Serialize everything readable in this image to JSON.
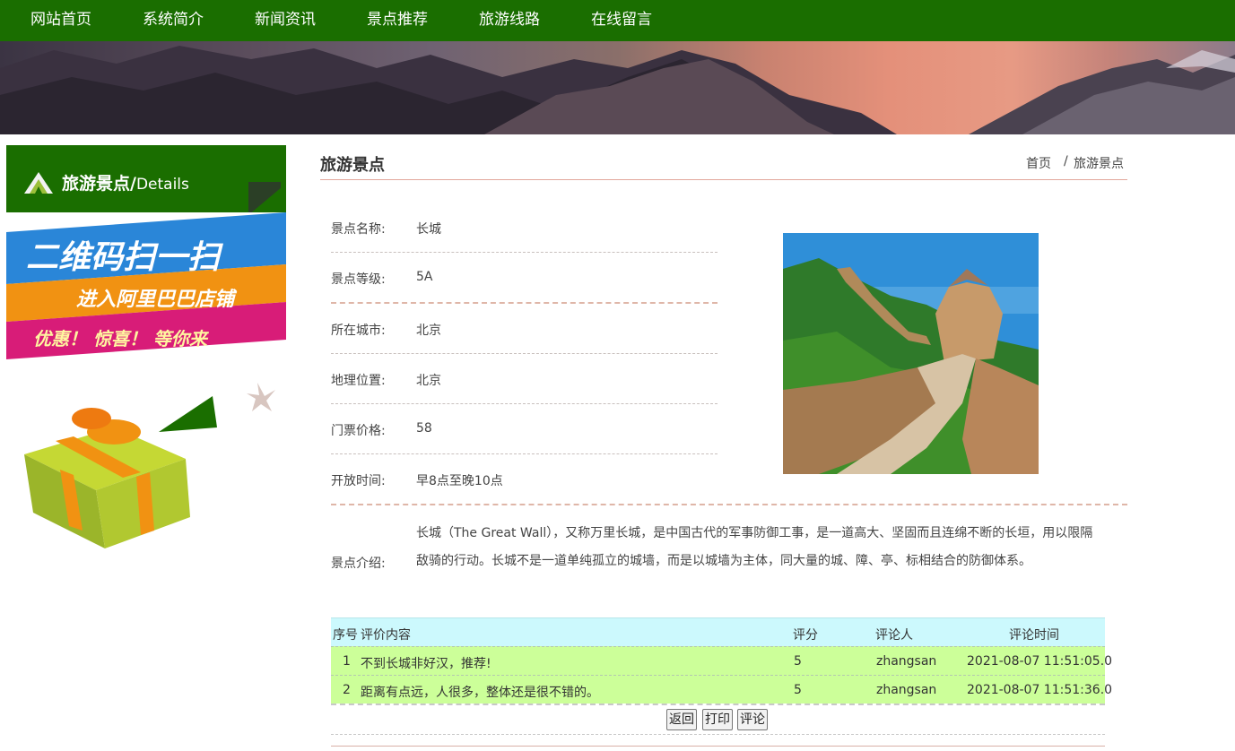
{
  "nav": {
    "items": [
      {
        "label": "网站首页"
      },
      {
        "label": "系统简介"
      },
      {
        "label": "新闻资讯"
      },
      {
        "label": "景点推荐"
      },
      {
        "label": "旅游线路"
      },
      {
        "label": "在线留言"
      }
    ]
  },
  "banner": {
    "slide_count": 5,
    "active_slide": 1
  },
  "sidebar": {
    "title": "旅游景点/",
    "title_sub": "Details",
    "promo": {
      "line1": "二维码扫一扫",
      "line2": "进入阿里巴巴店铺",
      "line3": "优惠！ 惊喜！ 等你来"
    }
  },
  "page": {
    "title": "旅游景点",
    "breadcrumb": {
      "home": "首页",
      "separator": "/",
      "current": "旅游景点"
    }
  },
  "details": {
    "name_label": "景点名称:",
    "name": "长城",
    "level_label": "景点等级:",
    "level": "5A",
    "city_label": "所在城市:",
    "city": "北京",
    "location_label": "地理位置:",
    "location": "北京",
    "price_label": "门票价格:",
    "price": "58",
    "hours_label": "开放时间:",
    "hours": "早8点至晚10点",
    "intro_label": "景点介绍:",
    "intro": "长城（The Great Wall），又称万里长城，是中国古代的军事防御工事，是一道高大、坚固而且连绵不断的长垣，用以限隔敌骑的行动。长城不是一道单纯孤立的城墙，而是以城墙为主体，同大量的城、障、亭、标相结合的防御体系。"
  },
  "reviews": {
    "headers": {
      "index": "序号",
      "content": "评价内容",
      "score": "评分",
      "reviewer": "评论人",
      "time": "评论时间"
    },
    "rows": [
      {
        "index": "1",
        "content": "不到长城非好汉，推荐!",
        "score": "5",
        "reviewer": "zhangsan",
        "time": "2021-08-07 11:51:05.0"
      },
      {
        "index": "2",
        "content": "距离有点远，人很多，整体还是很不错的。",
        "score": "5",
        "reviewer": "zhangsan",
        "time": "2021-08-07 11:51:36.0"
      }
    ]
  },
  "actions": {
    "back": "返回",
    "print": "打印",
    "comment": "评论"
  },
  "colors": {
    "nav_bg": "#1a6e00",
    "table_head": "#ccf9fd",
    "table_row": "#ccff99",
    "rule": "#e2a79c"
  }
}
